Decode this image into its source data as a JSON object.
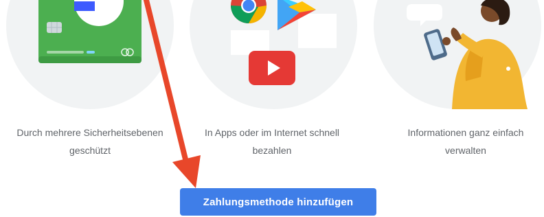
{
  "features": [
    {
      "line1": "Durch mehrere Sicherheitsebenen",
      "line2": "geschützt",
      "icon": "secure-card-icon"
    },
    {
      "line1": "In Apps oder im Internet schnell",
      "line2": "bezahlen",
      "icon": "apps-payment-icon"
    },
    {
      "line1": "Informationen ganz einfach",
      "line2": "verwalten",
      "icon": "woman-with-phone-icon"
    }
  ],
  "cta": {
    "label": "Zahlungsmethode hinzufügen"
  },
  "colors": {
    "button": "#3f7ee8",
    "circle": "#f1f3f4",
    "caption_text": "#5f6368",
    "arrow": "#e8472a",
    "card_green": "#4caf50"
  }
}
